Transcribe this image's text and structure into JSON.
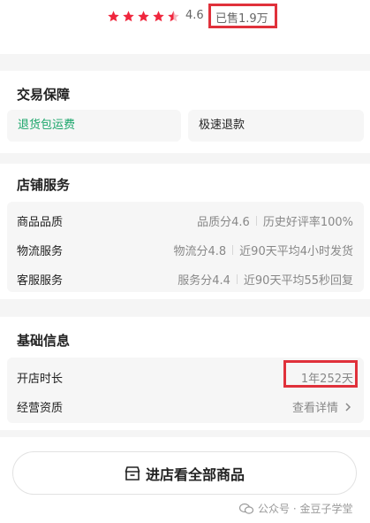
{
  "rating": {
    "score": "4.6",
    "stars": 4.5,
    "sold": "已售1.9万",
    "star_color": "#f0263d"
  },
  "guarantee": {
    "title": "交易保障",
    "items": [
      {
        "label": "退货包运费",
        "color": "#1aa56a"
      },
      {
        "label": "极速退款",
        "color": "#222222"
      }
    ]
  },
  "store_service": {
    "title": "店铺服务",
    "rows": [
      {
        "label": "商品品质",
        "score": "品质分4.6",
        "detail": "历史好评率100%"
      },
      {
        "label": "物流服务",
        "score": "物流分4.8",
        "detail": "近90天平均4小时发货"
      },
      {
        "label": "客服服务",
        "score": "服务分4.4",
        "detail": "近90天平均55秒回复"
      }
    ]
  },
  "basic_info": {
    "title": "基础信息",
    "rows": [
      {
        "label": "开店时长",
        "value": "1年252天"
      },
      {
        "label": "经营资质",
        "value": "查看详情"
      }
    ]
  },
  "enter_store": {
    "label": "进店看全部商品"
  },
  "watermark": {
    "text": "公众号 · 金豆子学堂"
  },
  "highlight_color": "#e0313b"
}
